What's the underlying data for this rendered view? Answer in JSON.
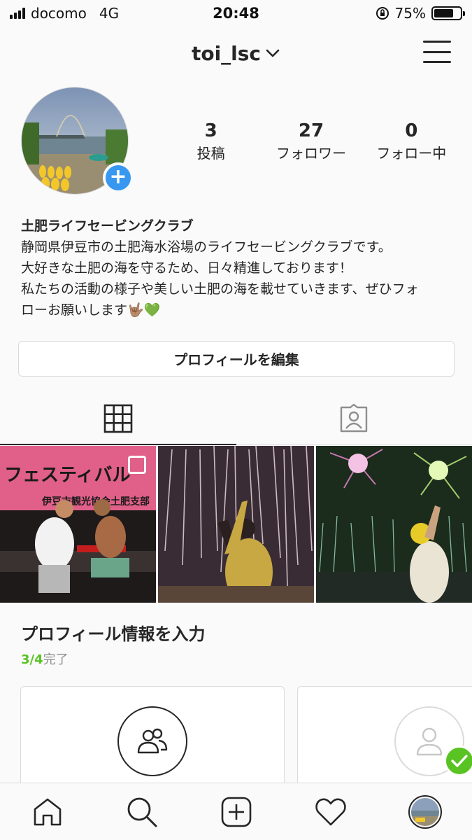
{
  "status_bar": {
    "carrier": "docomo",
    "network": "4G",
    "time": "20:48",
    "battery": "75%",
    "battery_level": 0.75
  },
  "header": {
    "username": "toi_lsc",
    "dropdown_icon": "chevron-down-icon",
    "menu_icon": "hamburger-menu-icon"
  },
  "stats": [
    {
      "count": "3",
      "label": "投稿"
    },
    {
      "count": "27",
      "label": "フォロワー"
    },
    {
      "count": "0",
      "label": "フォロー中"
    }
  ],
  "bio": {
    "name": "土肥ライフセービングクラブ",
    "lines": [
      "静岡県伊豆市の土肥海水浴場のライフセービングクラブです。",
      "大好きな土肥の海を守るため、日々精進しております！",
      "私たちの活動の様子や美しい土肥の海を載せていきます、ぜひフォ",
      "ローお願いします🤟🏽💚"
    ]
  },
  "edit_profile_label": "プロフィールを編集",
  "tabs": [
    {
      "icon": "grid-icon",
      "active": true
    },
    {
      "icon": "tagged-icon",
      "active": false
    }
  ],
  "posts": {
    "post1_texts": [
      "フェスティバル",
      "伊豆市観光協会土肥支部"
    ]
  },
  "profile_completion": {
    "title": "プロフィール情報を入力",
    "progress": "3/4",
    "progress_suffix": "完了"
  },
  "bottom_nav": [
    {
      "icon": "home-icon"
    },
    {
      "icon": "search-icon"
    },
    {
      "icon": "add-post-icon"
    },
    {
      "icon": "heart-icon"
    },
    {
      "icon": "profile-avatar"
    }
  ],
  "colors": {
    "accent_blue": "#3897f0",
    "progress_green": "#58c322",
    "text": "#262626",
    "border": "#dbdbdb"
  }
}
